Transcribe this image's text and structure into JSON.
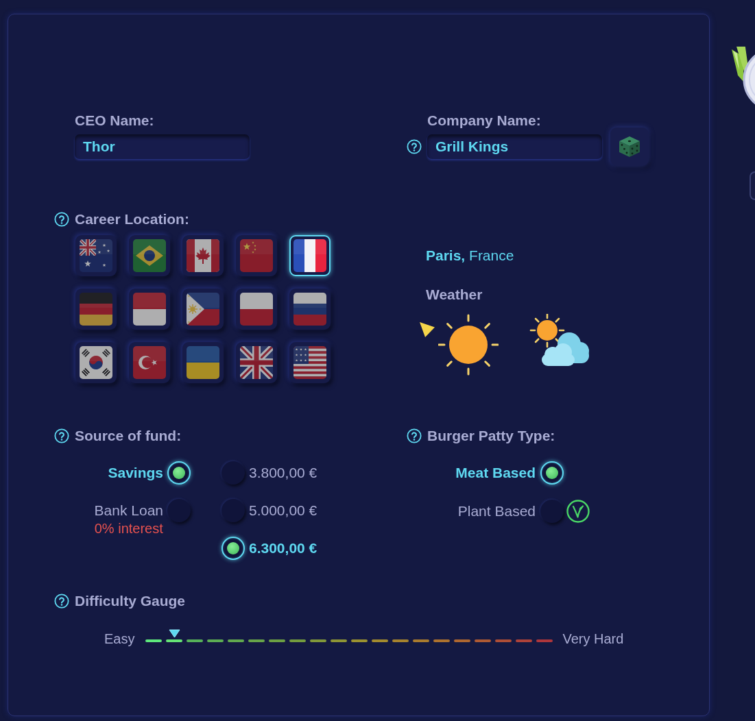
{
  "ceo_name": {
    "label": "CEO Name:",
    "value": "Thor",
    "help": false
  },
  "company_name": {
    "label": "Company Name:",
    "value": "Grill Kings",
    "help": true
  },
  "career_location": {
    "label": "Career Location:",
    "help": true,
    "flags": [
      {
        "kind": "australia",
        "selected": false
      },
      {
        "kind": "brazil",
        "selected": false
      },
      {
        "kind": "canada",
        "selected": false
      },
      {
        "kind": "china",
        "selected": false
      },
      {
        "kind": "france",
        "selected": true
      },
      {
        "kind": "germany",
        "selected": false
      },
      {
        "kind": "indonesia",
        "selected": false
      },
      {
        "kind": "philippines",
        "selected": false
      },
      {
        "kind": "poland",
        "selected": false
      },
      {
        "kind": "russia",
        "selected": false
      },
      {
        "kind": "south_korea",
        "selected": false
      },
      {
        "kind": "turkey",
        "selected": false
      },
      {
        "kind": "ukraine",
        "selected": false
      },
      {
        "kind": "united_kingdom",
        "selected": false
      },
      {
        "kind": "united_states",
        "selected": false
      }
    ]
  },
  "location": {
    "text": "**Paris,** France"
  },
  "weather": {
    "label": "Weather",
    "options": [
      {
        "kind": "sunny",
        "selected": true
      },
      {
        "kind": "partly_cloudy",
        "selected": false
      }
    ]
  },
  "source_of_fund": {
    "label": "Source of fund:",
    "help": true,
    "options": [
      {
        "label": "Savings",
        "selected": true
      },
      {
        "label": "Bank Loan",
        "note": "0% interest",
        "selected": false
      }
    ],
    "amounts": [
      {
        "label": "3.800,00 €",
        "selected": false
      },
      {
        "label": "5.000,00 €",
        "selected": false
      },
      {
        "label": "6.300,00 €",
        "selected": true
      }
    ]
  },
  "burger_patty_type": {
    "label": "Burger Patty Type:",
    "help": true,
    "options": [
      {
        "label": "Meat Based",
        "selected": true,
        "vegan": false
      },
      {
        "label": "Plant Based",
        "selected": false,
        "vegan": true
      }
    ]
  },
  "difficulty_gauge": {
    "label": "Difficulty Gauge",
    "help": true,
    "min_label": "Easy",
    "max_label": "Very Hard",
    "level": 0.07
  }
}
